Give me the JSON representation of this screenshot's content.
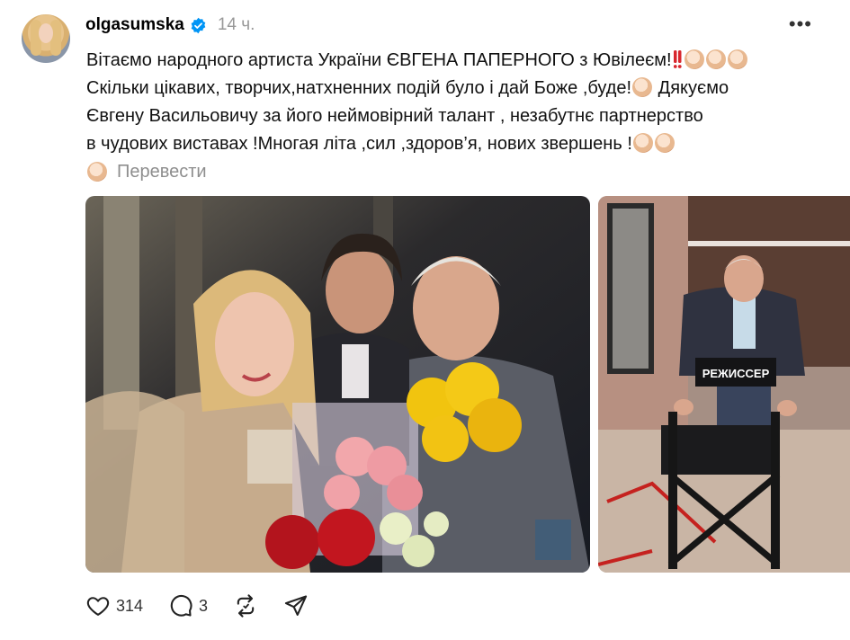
{
  "post": {
    "username": "olgasumska",
    "time": "14 ч.",
    "more_label": "•••",
    "lines": [
      "Вітаємо народного артиста України ЄВГЕНА ПАПЕРНОГО з Ювілеєм!",
      "Скільки цікавих, творчих,натхненних подій було і дай Боже ,буде!",
      " Дякуємо",
      "Євгену Васильовичу за його неймовірний талант , незабутнє партнерство",
      "в чудових виставах !Многая літа ,сил ,здоров’я, нових звершень !"
    ],
    "translate_label": "Перевести",
    "chair_label": "РЕЖИССЕР"
  },
  "actions": {
    "likes": "314",
    "comments": "3"
  },
  "colors": {
    "text": "#111111",
    "muted": "#8e8e8e",
    "verified": "#0095f6",
    "exclamation": "#d8262d"
  },
  "icons": [
    "verified-badge-icon",
    "more-options-icon",
    "clap-emoji-icon",
    "double-exclamation-icon",
    "pray-emoji-icon",
    "heart-icon",
    "comment-icon",
    "repost-icon",
    "share-icon"
  ]
}
